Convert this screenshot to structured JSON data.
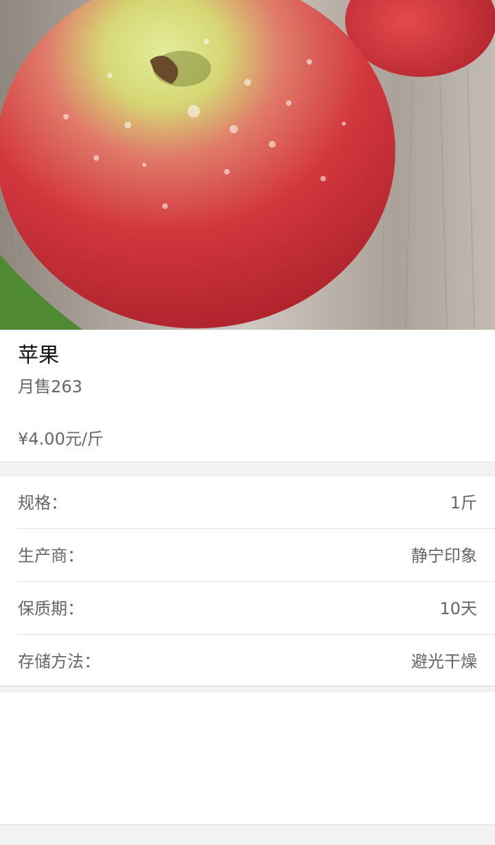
{
  "product": {
    "name": "苹果",
    "monthly_sales": "月售263",
    "price": "¥4.00元/斤"
  },
  "specs": [
    {
      "label": "规格：",
      "value": "1斤"
    },
    {
      "label": "生产商：",
      "value": "静宁印象"
    },
    {
      "label": "保质期：",
      "value": "10天"
    },
    {
      "label": "存储方法：",
      "value": "避光干燥"
    }
  ],
  "colors": {
    "apple_red": "#d43a3f",
    "apple_green": "#c9d96a",
    "wood": "#b9b1a8",
    "text_primary": "#111111",
    "text_secondary": "#666666",
    "divider": "#dedede",
    "background": "#f2f2f2"
  }
}
